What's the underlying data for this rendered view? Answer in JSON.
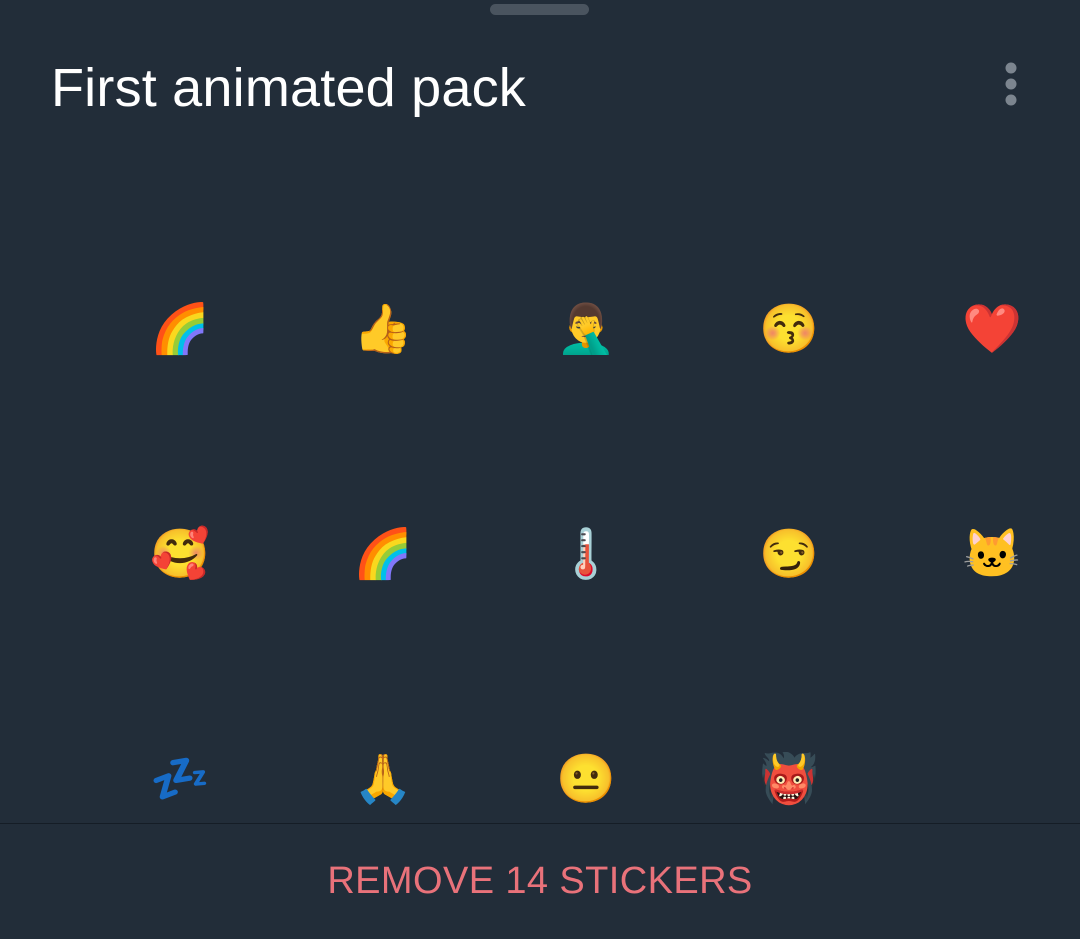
{
  "header": {
    "title": "First animated pack",
    "more_icon": "more-vertical-icon"
  },
  "stickers": [
    {
      "emoji": "🌈",
      "icon": "rainbow-icon"
    },
    {
      "emoji": "👍",
      "icon": "thumbs-up-icon"
    },
    {
      "emoji": "🤦‍♂️",
      "icon": "facepalm-icon"
    },
    {
      "emoji": "😚",
      "icon": "kissing-face-icon"
    },
    {
      "emoji": "❤️",
      "icon": "red-heart-icon"
    },
    {
      "emoji": "🥰",
      "icon": "smiling-face-with-hearts-icon"
    },
    {
      "emoji": "🌈",
      "icon": "rainbow-icon"
    },
    {
      "emoji": "🌡️",
      "icon": "thermometer-icon"
    },
    {
      "emoji": "😏",
      "icon": "smirking-face-icon"
    },
    {
      "emoji": "🐱",
      "icon": "cat-face-icon"
    },
    {
      "emoji": "💤",
      "icon": "zzz-icon"
    },
    {
      "emoji": "🙏",
      "icon": "folded-hands-icon"
    },
    {
      "emoji": "😐",
      "icon": "neutral-face-icon"
    },
    {
      "emoji": "👹",
      "icon": "ogre-icon"
    }
  ],
  "footer": {
    "remove_label": "REMOVE 14 STICKERS"
  },
  "colors": {
    "background": "#222d39",
    "title": "#ffffff",
    "destructive": "#e9727a",
    "handle": "#4a545f",
    "more_dots": "#7c858f"
  }
}
